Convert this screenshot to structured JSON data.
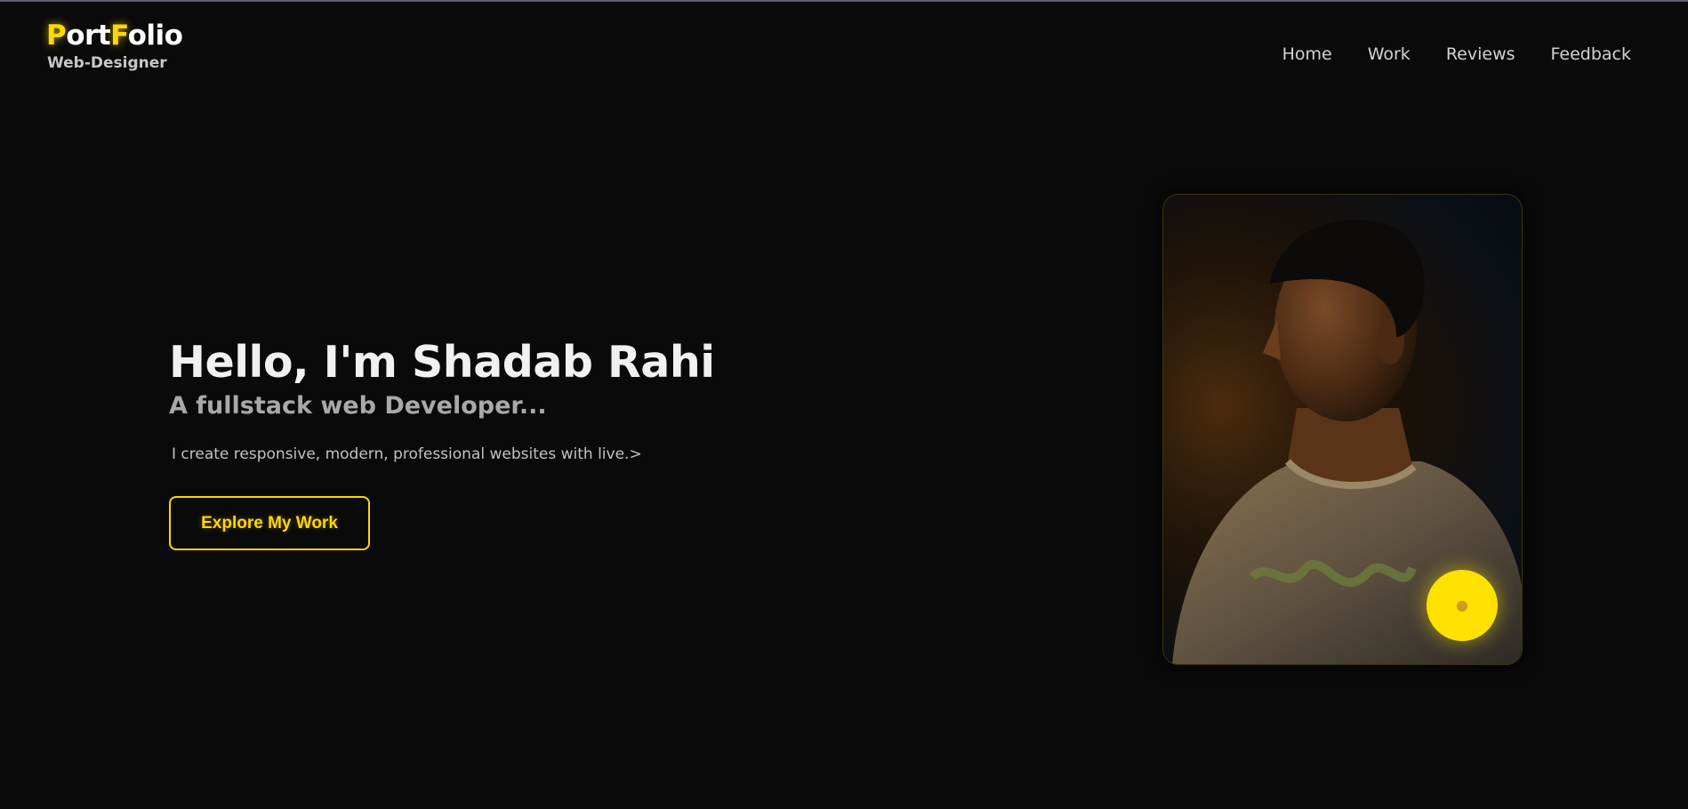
{
  "logo": {
    "title_parts": [
      "P",
      "ort",
      "F",
      "olio"
    ],
    "subtitle": "Web-Designer"
  },
  "nav": {
    "items": [
      "Home",
      "Work",
      "Reviews",
      "Feedback"
    ]
  },
  "hero": {
    "title": "Hello, I'm Shadab Rahi",
    "subtitle": "A fullstack web Developer...",
    "description": "I create responsive, modern, professional websites with live.>",
    "cta_label": "Explore My Work"
  },
  "profile": {
    "image_alt": "portrait photo",
    "theme_button_icon": "lightbulb-icon"
  },
  "colors": {
    "background": "#0a0a0a",
    "accent": "#ffd700",
    "text": "#f1f1f1",
    "muted": "#a9a9a9"
  }
}
